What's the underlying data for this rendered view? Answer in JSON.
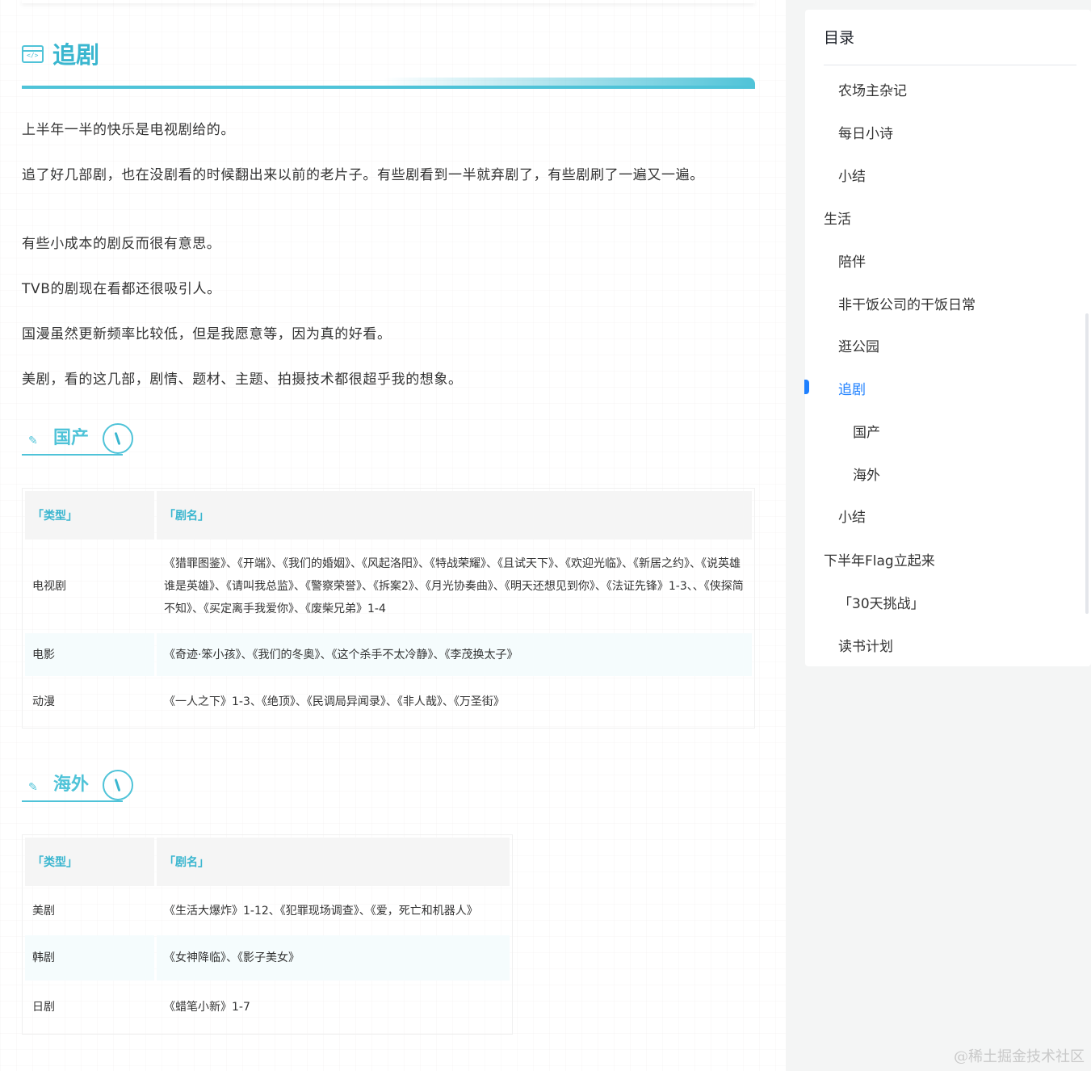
{
  "article": {
    "section_title": "追剧",
    "section_icon": "code-window-icon",
    "paragraphs": [
      "上半年一半的快乐是电视剧给的。",
      "追了好几部剧，也在没剧看的时候翻出来以前的老片子。有些剧看到一半就弃剧了，有些剧刷了一遍又一遍。",
      "有些小成本的剧反而很有意思。",
      "TVB的剧现在看都还很吸引人。",
      "国漫虽然更新频率比较低，但是我愿意等，因为真的好看。",
      "美剧，看的这几部，剧情、题材、主题、拍摄技术都很超乎我的想象。"
    ],
    "domestic": {
      "heading": "国产",
      "headers": [
        "「类型」",
        "「剧名」"
      ],
      "rows": [
        [
          "电视剧",
          "《猎罪图鉴》、《开端》、《我们的婚姻》、《风起洛阳》、《特战荣耀》、《且试天下》、《欢迎光临》、《新居之约》、《说英雄谁是英雄》、《请叫我总监》、《警察荣誉》、《拆案2》、《月光协奏曲》、《明天还想见到你》、《法证先锋》1-3、、《侠探简不知》、《买定离手我爱你》、《废柴兄弟》1-4"
        ],
        [
          "电影",
          "《奇迹·笨小孩》、《我们的冬奥》、《这个杀手不太冷静》、《李茂换太子》"
        ],
        [
          "动漫",
          "《一人之下》1-3、《绝顶》、《民调局异闻录》、《非人哉》、《万圣街》"
        ]
      ]
    },
    "overseas": {
      "heading": "海外",
      "headers": [
        "「类型」",
        "「剧名」"
      ],
      "rows": [
        [
          "美剧",
          "《生活大爆炸》1-12、《犯罪现场调查》、《爱，死亡和机器人》"
        ],
        [
          "韩剧",
          "《女神降临》、《影子美女》"
        ],
        [
          "日剧",
          "《蜡笔小新》1-7"
        ]
      ]
    }
  },
  "toc": {
    "title": "目录",
    "items": [
      {
        "label": "农场主杂记",
        "level": 2
      },
      {
        "label": "每日小诗",
        "level": 2
      },
      {
        "label": "小结",
        "level": 2
      },
      {
        "label": "生活",
        "level": 1
      },
      {
        "label": "陪伴",
        "level": 2
      },
      {
        "label": "非干饭公司的干饭日常",
        "level": 2
      },
      {
        "label": "逛公园",
        "level": 2
      },
      {
        "label": "追剧",
        "level": 2,
        "active": true
      },
      {
        "label": "国产",
        "level": 3
      },
      {
        "label": "海外",
        "level": 3
      },
      {
        "label": "小结",
        "level": 2
      },
      {
        "label": "下半年Flag立起来",
        "level": 1
      },
      {
        "label": "「30天挑战」",
        "level": 2
      },
      {
        "label": "读书计划",
        "level": 2
      }
    ]
  },
  "watermark": "@稀土掘金技术社区",
  "colors": {
    "accent": "#4fc3d8",
    "toc_active": "#1e80ff"
  }
}
